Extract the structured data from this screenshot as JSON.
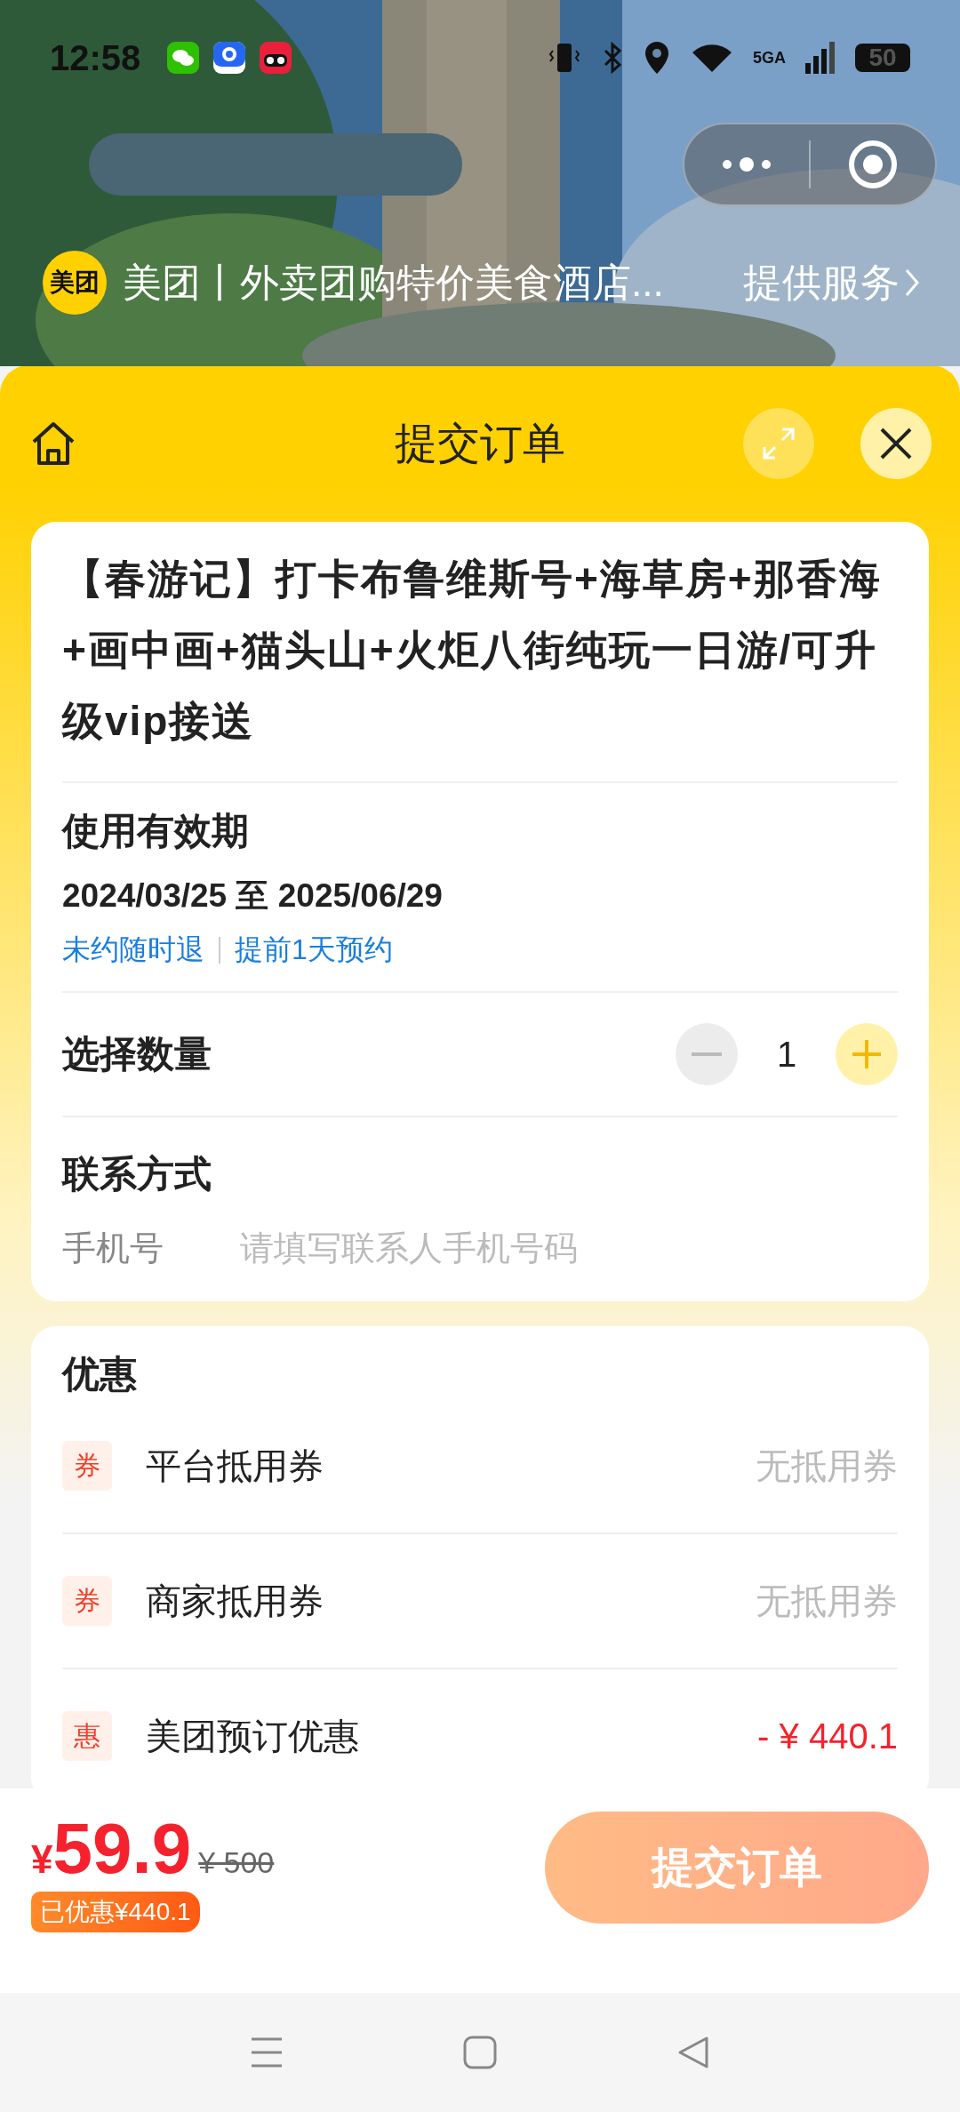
{
  "status_bar": {
    "time": "12:58",
    "network": "5GA",
    "battery": "50"
  },
  "mini_app": {
    "logo": "美团",
    "title": "美团丨外卖团购特价美食酒店...",
    "service_link": "提供服务"
  },
  "header": {
    "title": "提交订单"
  },
  "product": {
    "title": "【春游记】打卡布鲁维斯号+海草房+那香海+画中画+猫头山+火炬八街纯玩一日游/可升级vip接送"
  },
  "validity": {
    "label": "使用有效期",
    "dates": "2024/03/25 至 2025/06/29",
    "tags": [
      "未约随时退",
      "提前1天预约"
    ]
  },
  "quantity": {
    "label": "选择数量",
    "value": "1",
    "decrease_disabled": true
  },
  "contact": {
    "label": "联系方式",
    "field_label": "手机号",
    "placeholder": "请填写联系人手机号码"
  },
  "discounts": {
    "title": "优惠",
    "rows": [
      {
        "badge": "券",
        "label": "平台抵用券",
        "value": "无抵用券",
        "kind": "none"
      },
      {
        "badge": "券",
        "label": "商家抵用券",
        "value": "无抵用券",
        "kind": "none"
      },
      {
        "badge": "惠",
        "label": "美团预订优惠",
        "value": "- ¥ 440.1",
        "kind": "amount"
      }
    ]
  },
  "footer": {
    "currency": "¥",
    "price": "59.9",
    "original_price": "¥ 500",
    "saved": "已优惠¥440.1",
    "submit": "提交订单"
  }
}
